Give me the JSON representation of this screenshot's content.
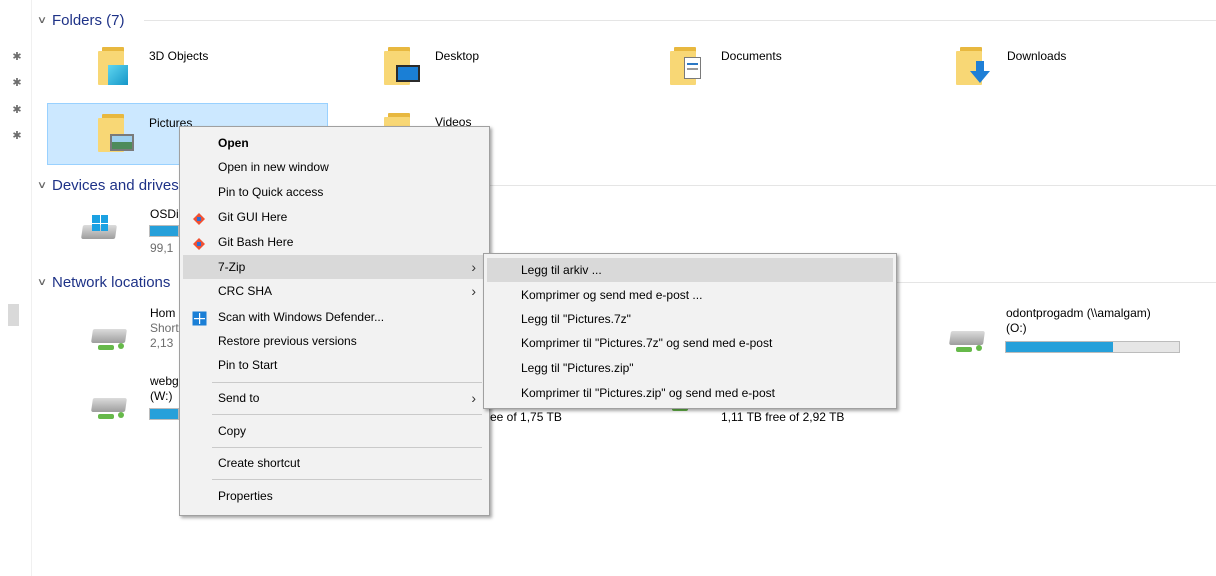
{
  "groups": {
    "folders": "Folders (7)",
    "devices": "Devices and drives",
    "network": "Network locations"
  },
  "folders": [
    {
      "name": "3D Objects",
      "icon": "3d-objects-folder-icon"
    },
    {
      "name": "Desktop",
      "icon": "desktop-folder-icon"
    },
    {
      "name": "Documents",
      "icon": "documents-folder-icon"
    },
    {
      "name": "Downloads",
      "icon": "downloads-folder-icon"
    },
    {
      "name": "Pictures",
      "icon": "pictures-folder-icon"
    },
    {
      "name": "Videos",
      "icon": "videos-folder-icon"
    }
  ],
  "devices": {
    "osdisk": {
      "name": "OSDi",
      "sub": "99,1"
    }
  },
  "network": {
    "home": {
      "name": "Hom",
      "sub1": "Short",
      "sub2": "2,13"
    },
    "webg": {
      "name": "webg",
      "sub": "(W:)",
      "fill": 0.9
    },
    "odontprog": {
      "name": "odontprogadm (\\\\amalgam)",
      "sub": "(O:)",
      "fill": 0.62
    },
    "mid1_free": "ee of 1,75 TB",
    "mid2_free": "1,11 TB free of 2,92 TB"
  },
  "context_menu": {
    "items": [
      {
        "label": "Open"
      },
      {
        "label": "Open in new window"
      },
      {
        "label": "Pin to Quick access"
      },
      {
        "label": "Git GUI Here",
        "icon": "git-icon"
      },
      {
        "label": "Git Bash Here",
        "icon": "git-icon"
      },
      {
        "label": "7-Zip"
      },
      {
        "label": "CRC SHA"
      },
      {
        "label": "Scan with Windows Defender...",
        "icon": "windows-defender-icon"
      },
      {
        "label": "Restore previous versions"
      },
      {
        "label": "Pin to Start"
      },
      {
        "label": "Send to"
      },
      {
        "label": "Copy"
      },
      {
        "label": "Create shortcut"
      },
      {
        "label": "Properties"
      }
    ]
  },
  "submenu_7zip": {
    "items": [
      {
        "label": "Legg til arkiv ..."
      },
      {
        "label": "Komprimer og send med e-post ..."
      },
      {
        "label": "Legg til \"Pictures.7z\""
      },
      {
        "label": "Komprimer til \"Pictures.7z\" og send med e-post"
      },
      {
        "label": "Legg til \"Pictures.zip\""
      },
      {
        "label": "Komprimer til \"Pictures.zip\" og send med e-post"
      }
    ]
  },
  "colors": {
    "group_header": "#1e3287",
    "selection": "#cce8ff",
    "drive_bar": "#26a0da",
    "menu_bg": "#f2f2f2"
  }
}
